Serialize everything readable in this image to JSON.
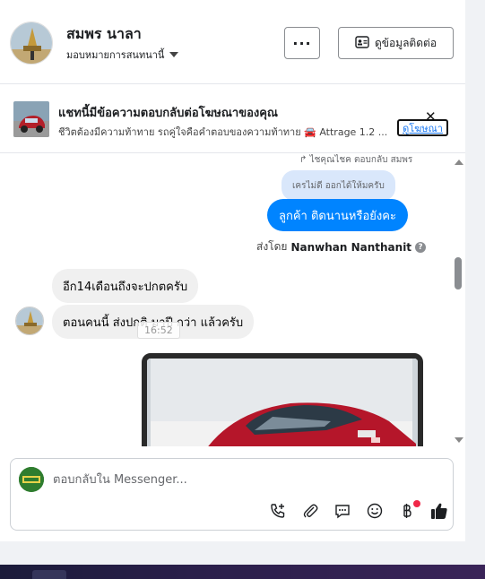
{
  "header": {
    "page_name": "สมพร นาลา",
    "page_sub": "มอบหมายการสนทนานี้",
    "more_label": "···",
    "contact_label": "ดูข้อมูลติดต่อ"
  },
  "ad_context": {
    "title": "แชทนี้มีข้อความตอบกลับต่อโฆษณาของคุณ",
    "description": "ชีวิตต้องมีความท้าทาย รถคู่ใจคือคำตอบของความท้าทาย 🚘 Attrage 1.2 ...",
    "link_label": "ดูโฆษณา",
    "close_label": "✕"
  },
  "conversation": {
    "reply_note": "ไชคุณไชค ตอบกลับ สมพร",
    "quoted_text": "เครไม่ดี ออกได้ให้มครับ",
    "outgoing_message": "ลูกค้า ติดนานหรือยังคะ",
    "sent_by_prefix": "ส่งโดย",
    "sent_by_name": "Nanwhan Nanthanit",
    "help_label": "?",
    "incoming_1": "อีก14เดือนถึงจะปกตครับ",
    "incoming_2": "ตอนคนนี้ ส่งปกติ มาปี กว่า แล้วครับ",
    "hover_time": "16:52"
  },
  "composer": {
    "placeholder": "ตอบกลับใน Messenger..."
  },
  "colors": {
    "accent_blue": "#0084ff",
    "quoted_bg": "#d9e7fb",
    "incoming_bg": "#f0f0f0",
    "notification_red": "#f02849"
  },
  "icons": [
    "call-add-icon",
    "attachment-icon",
    "saved-reply-icon",
    "emoji-icon",
    "baht-payment-icon",
    "thumbs-up-icon"
  ]
}
